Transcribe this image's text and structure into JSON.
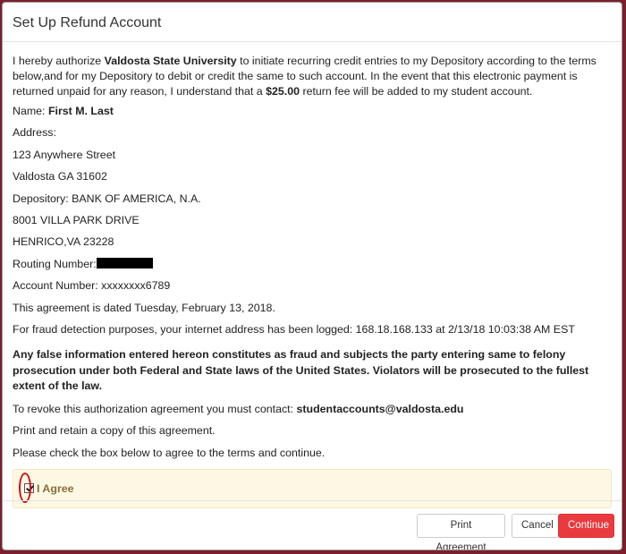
{
  "dialog": {
    "title": "Set Up Refund Account"
  },
  "body": {
    "intro": {
      "t1": "I hereby authorize ",
      "university": "Valdosta State University",
      "t2": " to initiate recurring credit entries to my Depository according to the terms below,and for my Depository to debit or credit the same to such account. In the event that this electronic payment is returned unpaid for any reason, I understand that a ",
      "fee": "$25.00",
      "t3": " return fee will be added to my student account."
    },
    "name_label": "Name: ",
    "name_value": "First M. Last",
    "address_label": "Address:",
    "address_line1": "123 Anywhere Street",
    "address_line2": "Valdosta GA 31602",
    "depository": "Depository: BANK OF AMERICA, N.A.",
    "depository_address1": "8001 VILLA PARK DRIVE",
    "depository_address2": "HENRICO,VA 23228",
    "routing_label": "Routing Number:",
    "account": "Account Number: xxxxxxxx6789",
    "agreement_date": "This agreement is dated Tuesday, February 13, 2018.",
    "fraud_notice": "For fraud detection purposes, your internet address has been logged: 168.18.168.133 at 2/13/18 10:03:38 AM EST",
    "warning": "Any false information entered hereon constitutes as fraud and subjects the party entering same to felony prosecution under both Federal and State laws of the United States. Violators will be prosecuted to the fullest extent of the law.",
    "revoke_text": "To revoke this authorization agreement you must contact: ",
    "revoke_email": "studentaccounts@valdosta.edu",
    "print_notice": "Print and retain a copy of this agreement.",
    "check_instruction": "Please check the box below to agree to the terms and continue."
  },
  "agree": {
    "label": "I Agree",
    "checked": true
  },
  "footer": {
    "print_label": "Print Agreement",
    "cancel_label": "Cancel",
    "continue_label": "Continue"
  },
  "colors": {
    "continue_button": "#e83a3f",
    "agree_panel": "#fcf8e3",
    "annotation_ring": "#d0101a"
  }
}
